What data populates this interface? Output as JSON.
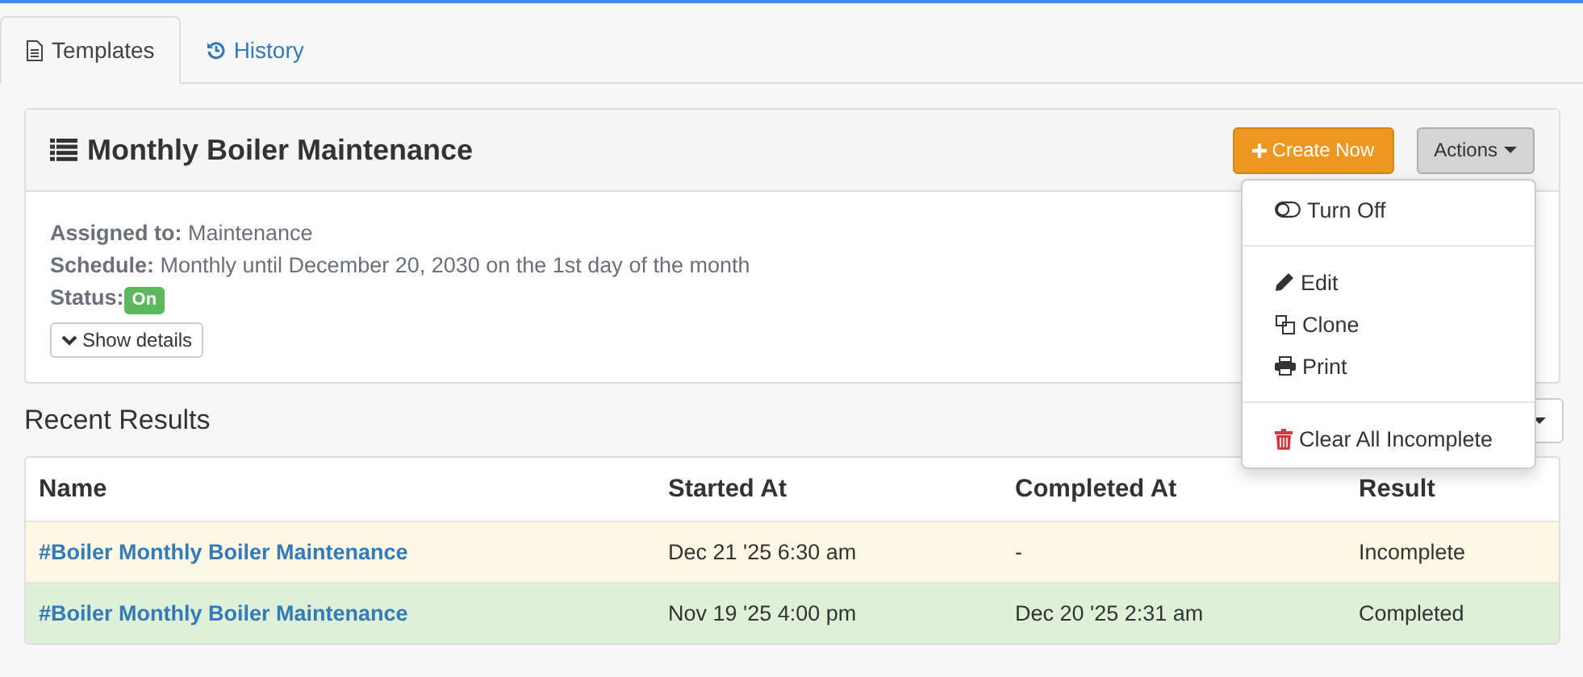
{
  "tabs": [
    {
      "label": "Templates",
      "selected": true
    },
    {
      "label": "History",
      "selected": false
    }
  ],
  "template": {
    "title": "Monthly Boiler Maintenance",
    "create_button": "Create Now",
    "actions_button": "Actions",
    "fields": [
      {
        "label": "Assigned to:",
        "value": "Maintenance"
      },
      {
        "label": "Schedule:",
        "value": "Monthly until December 20, 2030 on the 1st day of the month"
      }
    ],
    "status_label": "Status:",
    "status": {
      "text": "On",
      "on": true
    },
    "details_button": "Show details"
  },
  "actions_menu": {
    "groups": [
      [
        {
          "label": "Turn Off",
          "kind": "toggle"
        }
      ],
      [
        {
          "label": "Edit",
          "kind": "edit"
        },
        {
          "label": "Clone",
          "kind": "clone"
        },
        {
          "label": "Print",
          "kind": "print"
        }
      ],
      [
        {
          "label": "Clear All Incomplete",
          "kind": "delete"
        }
      ]
    ]
  },
  "recent_results": {
    "title": "Recent Results",
    "columns": [
      "Name",
      "Started At",
      "Completed At",
      "Result"
    ],
    "rows": [
      {
        "kind": "warning",
        "name": "#Boiler Monthly Boiler Maintenance",
        "started": "Dec 21 '25 6:30 am",
        "completed": "-",
        "result": "Incomplete"
      },
      {
        "kind": "success",
        "name": "#Boiler Monthly Boiler Maintenance",
        "started": "Nov 19 '25 4:00 pm",
        "completed": "Dec 20 '25 2:31 am",
        "result": "Completed"
      }
    ]
  }
}
